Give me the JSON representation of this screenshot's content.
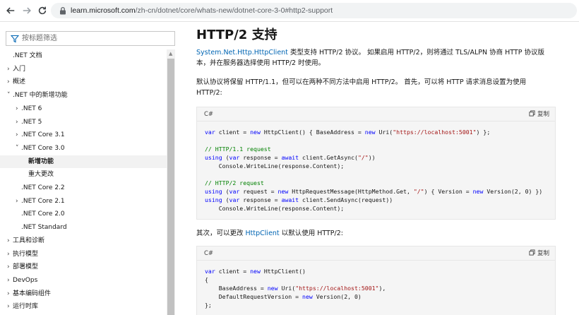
{
  "browser": {
    "url_host": "learn.microsoft.com",
    "url_path": "/zh-cn/dotnet/core/whats-new/dotnet-core-3-0#http2-support"
  },
  "sidebar": {
    "filter_placeholder": "按标题筛选",
    "items": [
      {
        "label": ".NET 文档",
        "chevron": "",
        "level": 0
      },
      {
        "label": "入门",
        "chevron": "›",
        "level": 0
      },
      {
        "label": "概述",
        "chevron": "›",
        "level": 0
      },
      {
        "label": ".NET 中的新增功能",
        "chevron": "˅",
        "level": 0
      },
      {
        "label": ".NET 6",
        "chevron": "›",
        "level": 1
      },
      {
        "label": ".NET 5",
        "chevron": "›",
        "level": 1
      },
      {
        "label": ".NET Core 3.1",
        "chevron": "›",
        "level": 1
      },
      {
        "label": ".NET Core 3.0",
        "chevron": "˅",
        "level": 1
      },
      {
        "label": "新增功能",
        "chevron": "",
        "level": 2,
        "active": true
      },
      {
        "label": "重大更改",
        "chevron": "",
        "level": 2
      },
      {
        "label": ".NET Core 2.2",
        "chevron": "",
        "level": 1
      },
      {
        "label": ".NET Core 2.1",
        "chevron": "›",
        "level": 1
      },
      {
        "label": ".NET Core 2.0",
        "chevron": "",
        "level": 1
      },
      {
        "label": ".NET Standard",
        "chevron": "",
        "level": 1
      },
      {
        "label": "工具和诊断",
        "chevron": "›",
        "level": 0
      },
      {
        "label": "执行模型",
        "chevron": "›",
        "level": 0
      },
      {
        "label": "部署模型",
        "chevron": "›",
        "level": 0
      },
      {
        "label": "DevOps",
        "chevron": "›",
        "level": 0
      },
      {
        "label": "基本编码组件",
        "chevron": "›",
        "level": 0
      },
      {
        "label": "运行时库",
        "chevron": "›",
        "level": 0
      }
    ]
  },
  "main": {
    "title": "HTTP/2 支持",
    "p1_link": "System.Net.Http.HttpClient",
    "p1_line1_rest": " 类型支持 HTTP/2 协议。 如果启用 HTTP/2，则将通过 TLS/ALPN 协商 HTTP 协议版",
    "p1_line2": "本，并在服务器选择使用 HTTP/2 时使用。",
    "p2_line1": "默认协议将保留 HTTP/1.1，但可以在两种不同方法中启用 HTTP/2。 首先，可以将 HTTP 请求消息设置为使用",
    "p2_line2": "HTTP/2:",
    "p3_pre": "其次，可以更改 ",
    "p3_link": "HttpClient",
    "p3_post": " 以默认使用 HTTP/2:",
    "code_lang": "C#",
    "copy_label": "复制"
  }
}
